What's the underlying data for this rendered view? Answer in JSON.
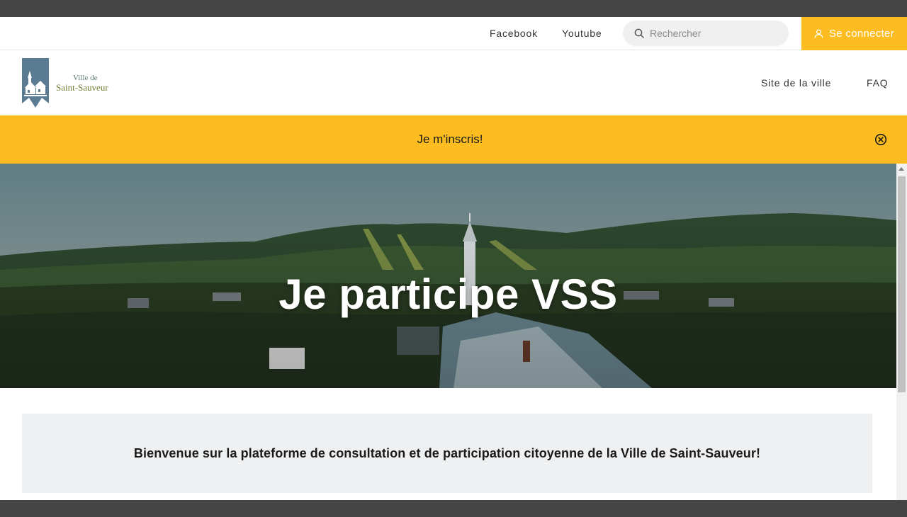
{
  "utility_bar": {
    "links": [
      {
        "label": "Facebook"
      },
      {
        "label": "Youtube"
      }
    ],
    "search": {
      "placeholder": "Rechercher",
      "icon": "search-icon"
    },
    "login": {
      "label": "Se connecter",
      "icon": "user-icon"
    }
  },
  "header": {
    "logo": {
      "line1": "Ville de",
      "line2": "Saint-Sauveur"
    },
    "nav": [
      {
        "label": "Site de la ville"
      },
      {
        "label": "FAQ"
      }
    ]
  },
  "banner": {
    "text": "Je m'inscris!",
    "close_icon": "close-circle-icon"
  },
  "hero": {
    "title": "Je participe VSS"
  },
  "welcome": {
    "text": "Bienvenue sur la plateforme de consultation et de participation citoyenne de la Ville de Saint-Sauveur!"
  },
  "colors": {
    "accent": "#fdbc1f",
    "text": "#1a1a1a",
    "card_bg": "#eff0f1",
    "logo_blue": "#5b7b93",
    "logo_green": "#6e7d33"
  }
}
